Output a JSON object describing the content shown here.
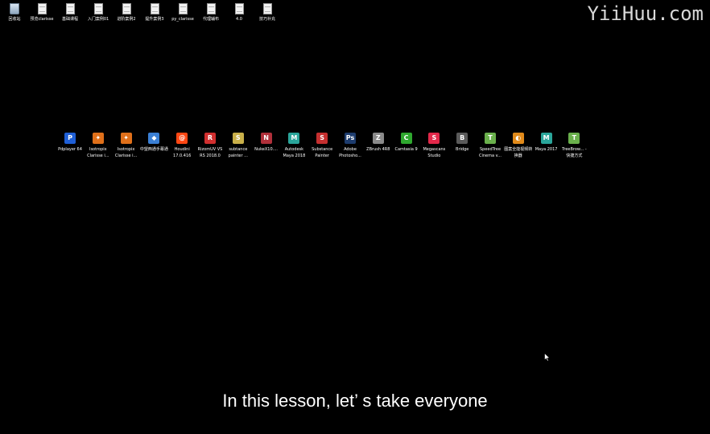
{
  "watermark": "YiiHuu.com",
  "subtitle": "In this lesson, let’ s take everyone",
  "top_icons": [
    {
      "label": "回收站",
      "icon": "recycle-bin-icon"
    },
    {
      "label": "预览clarisse",
      "icon": "file-icon"
    },
    {
      "label": "基础课程",
      "icon": "file-icon"
    },
    {
      "label": "入门案例01",
      "icon": "file-icon"
    },
    {
      "label": "进阶案例2",
      "icon": "file-icon"
    },
    {
      "label": "提升案例3",
      "icon": "file-icon"
    },
    {
      "label": "py_clarisse",
      "icon": "file-icon"
    },
    {
      "label": "代理辅布",
      "icon": "file-icon"
    },
    {
      "label": "4.0",
      "icon": "file-icon"
    },
    {
      "label": "技巧补充",
      "icon": "file-icon"
    }
  ],
  "app_icons": [
    {
      "label": "Pdplayer 64",
      "icon": "pdplayer-icon",
      "color": "#1f5fd6",
      "glyph": "P"
    },
    {
      "label": "Isotropix Clarisse i...",
      "icon": "clarisse-icon",
      "color": "#e0701a",
      "glyph": "✦"
    },
    {
      "label": "Isotropix Clarisse i...",
      "icon": "clarisse-icon",
      "color": "#e0701a",
      "glyph": "✦"
    },
    {
      "label": "中望西通手幕通",
      "icon": "app-icon",
      "color": "#3a7fd4",
      "glyph": "◆"
    },
    {
      "label": "Houdini 17.0.416",
      "icon": "houdini-icon",
      "color": "#ff4713",
      "glyph": "@"
    },
    {
      "label": "RizomUV VS RS 2018.0",
      "icon": "rizomuv-icon",
      "color": "#d12f2f",
      "glyph": "R"
    },
    {
      "label": "subtance painter ...",
      "icon": "substance-icon",
      "color": "#c9b04a",
      "glyph": "S"
    },
    {
      "label": "NukeX10....",
      "icon": "nuke-icon",
      "color": "#b0303a",
      "glyph": "N"
    },
    {
      "label": "Autodesk Maya 2018",
      "icon": "maya-icon",
      "color": "#2aa59a",
      "glyph": "M"
    },
    {
      "label": "Substance Painter",
      "icon": "substance-painter-icon",
      "color": "#c52f2f",
      "glyph": "S"
    },
    {
      "label": "Adobe Photosho...",
      "icon": "photoshop-icon",
      "color": "#1d3c6e",
      "glyph": "Ps"
    },
    {
      "label": "ZBrush 4R8",
      "icon": "zbrush-icon",
      "color": "#8a8a8a",
      "glyph": "Z"
    },
    {
      "label": "Camtasia 9",
      "icon": "camtasia-icon",
      "color": "#2fa82f",
      "glyph": "C"
    },
    {
      "label": "Megascans Studio",
      "icon": "megascans-icon",
      "color": "#e2284a",
      "glyph": "S"
    },
    {
      "label": "Bridge",
      "icon": "bridge-icon",
      "color": "#5a5a5a",
      "glyph": "B"
    },
    {
      "label": "SpeedTree Cinema v...",
      "icon": "speedtree-icon",
      "color": "#6ab04c",
      "glyph": "T"
    },
    {
      "label": "图案全能视频转换器",
      "icon": "converter-icon",
      "color": "#e08a1a",
      "glyph": "◐"
    },
    {
      "label": "Maya 2017",
      "icon": "maya-icon",
      "color": "#2aa59a",
      "glyph": "M"
    },
    {
      "label": "TreeBrow... - 快捷方式",
      "icon": "treebrowser-icon",
      "color": "#6ab04c",
      "glyph": "T"
    }
  ]
}
